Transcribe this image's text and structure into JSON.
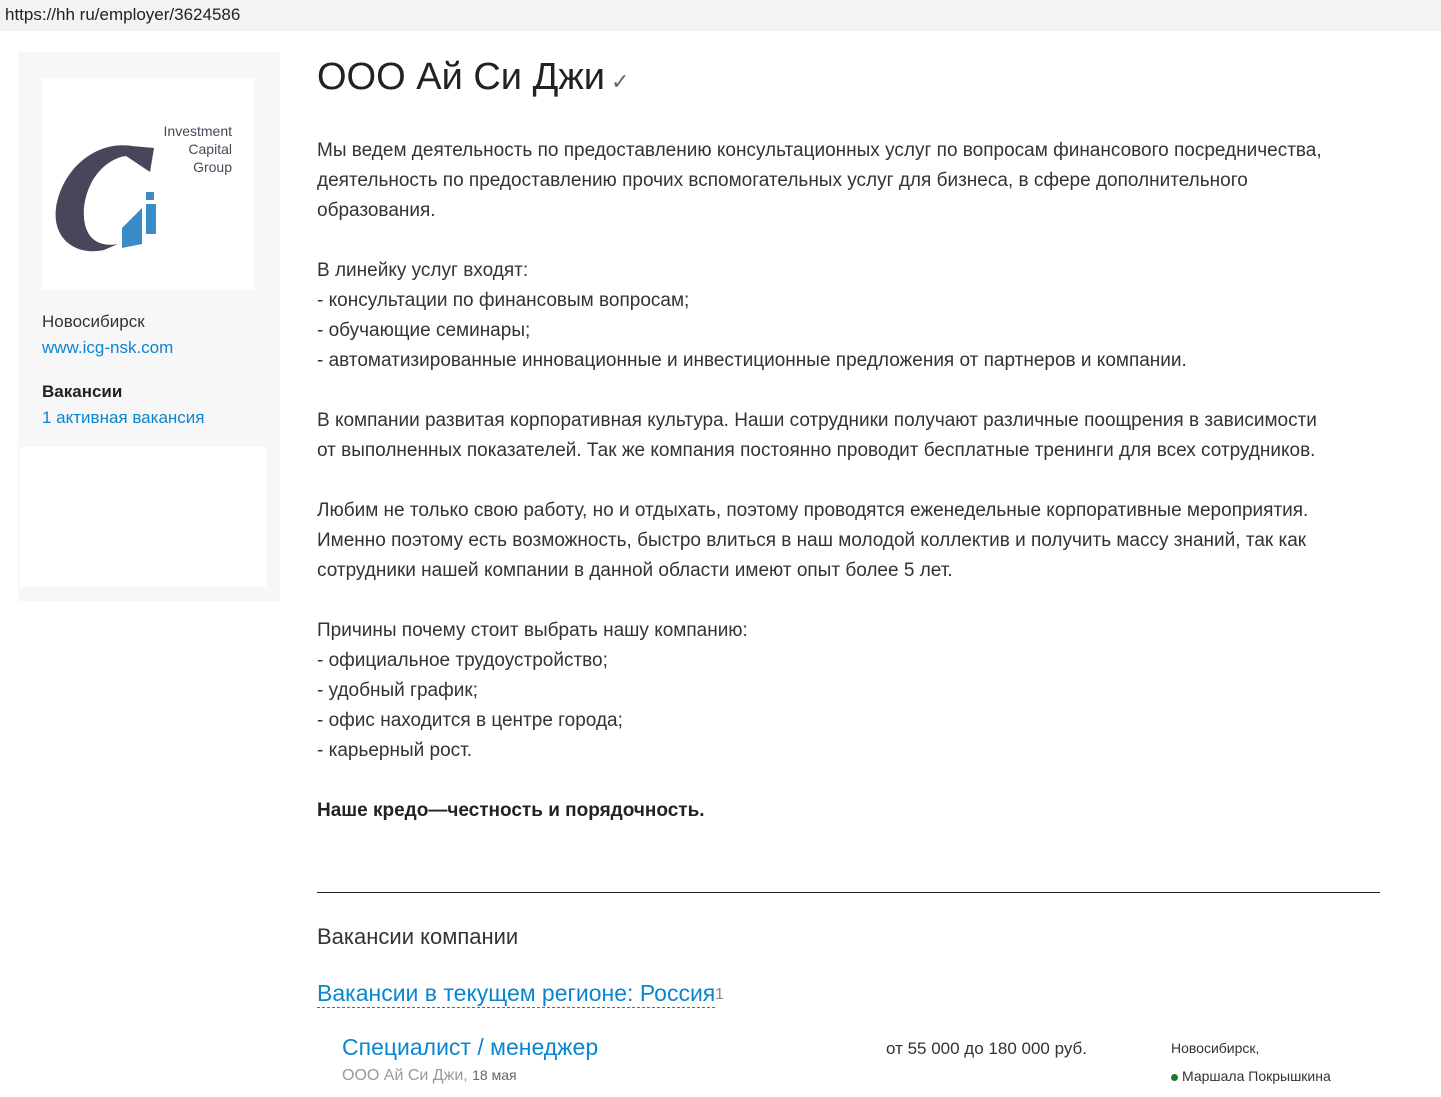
{
  "browser": {
    "url": "https://hh ru/employer/3624586"
  },
  "sidebar": {
    "logo_text": [
      "Investment",
      "Capital",
      "Group"
    ],
    "city": "Новосибирск",
    "website": "www.icg-nsk.com",
    "vacancies_heading": "Вакансии",
    "vacancies_link": "1 активная вакансия"
  },
  "company": {
    "name": "ООО Ай Си Джи",
    "verified_icon": "✓",
    "description": [
      [
        "Мы ведем деятельность по предоставлению консультационных услуг по вопросам финансового посредничества,",
        "деятельность по предоставлению прочих вспомогательных услуг для бизнеса, в сфере дополнительного",
        "образования."
      ],
      [
        "В линейку услуг входят:",
        "- консультации по финансовым вопросам;",
        "- обучающие семинары;",
        "- автоматизированные инновационные и инвестиционные предложения от партнеров и компании."
      ],
      [
        "В компании развитая корпоративная культура. Наши сотрудники получают различные поощрения в зависимости",
        "от выполненных показателей. Так же компания постоянно проводит бесплатные тренинги для всех сотрудников."
      ],
      [
        "Любим не только свою работу, но и отдыхать, поэтому проводятся еженедельные корпоративные мероприятия.",
        "Именно поэтому есть возможность, быстро влиться в наш молодой коллектив и получить массу знаний, так как",
        "сотрудники нашей компании в данной области имеют опыт более 5 лет."
      ],
      [
        "Причины почему стоит выбрать нашу компанию:",
        "- официальное трудоустройство;",
        "- удобный график;",
        "- офис находится в центре города;",
        "- карьерный рост."
      ]
    ],
    "motto": "Наше кредо—честность и порядочность."
  },
  "vacancies": {
    "heading": "Вакансии компании",
    "region_label": "Вакансии в текущем регионе: Россия",
    "region_count": "1",
    "items": [
      {
        "title": "Специалист / менеджер",
        "company": "ООО Ай Си Джи",
        "date": "18 мая",
        "salary": "от 55 000 до 180 000 руб.",
        "city": "Новосибирск,",
        "metro": "Маршала Покрышкина",
        "metro_color": "#1a7a2a"
      }
    ]
  }
}
